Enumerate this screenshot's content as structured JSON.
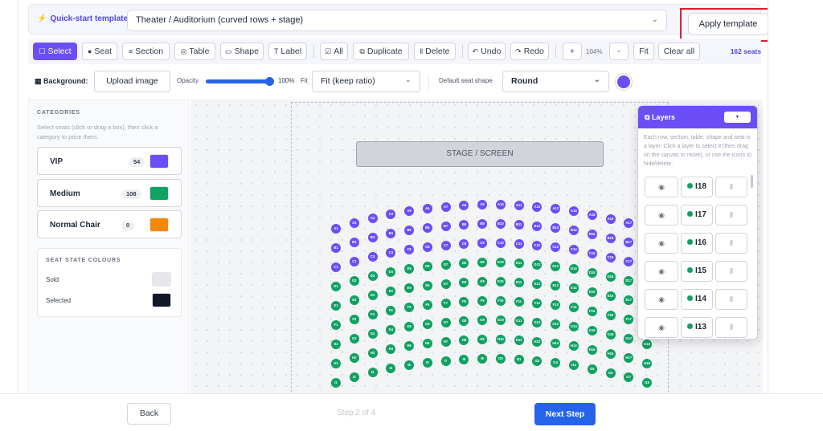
{
  "quickstart": {
    "label": "Quick-start template:",
    "selected": "Theater / Auditorium (curved rows + stage)",
    "apply_label": "Apply template"
  },
  "toolbar": {
    "buttons": [
      {
        "label": "Select",
        "icon": "☐"
      },
      {
        "label": "Seat",
        "icon": "●"
      },
      {
        "label": "Section",
        "icon": "≡"
      },
      {
        "label": "Table",
        "icon": "◎"
      },
      {
        "label": "Shape",
        "icon": "▭"
      },
      {
        "label": "Label",
        "icon": "T"
      },
      {
        "label": "All",
        "icon": "☑"
      },
      {
        "label": "Duplicate",
        "icon": "⧉"
      },
      {
        "label": "Delete",
        "icon": "‖"
      },
      {
        "label": "Undo",
        "icon": "↶"
      },
      {
        "label": "Redo",
        "icon": "↷"
      }
    ],
    "zoom_in": "+",
    "zoom_level": "104%",
    "zoom_out": "-",
    "fit": "Fit",
    "clear": "Clear all",
    "seat_count": "162 seats"
  },
  "background": {
    "label": "Background:",
    "upload": "Upload image",
    "opacity_label": "Opacity",
    "opacity_value": "100%",
    "opacity": 1.0,
    "fit_label": "Fit",
    "fit_value": "Fit (keep ratio)",
    "shape_label": "Default seat shape",
    "shape_value": "Round",
    "seat_color": "#6b4ef5"
  },
  "sidebar": {
    "categories_title": "CATEGORIES",
    "help": "Select seats (click or drag a box), then click a category to price them.",
    "categories": [
      {
        "name": "VIP",
        "count": "54",
        "color": "#6b4ef5"
      },
      {
        "name": "Medium",
        "count": "108",
        "color": "#10a163"
      },
      {
        "name": "Normal Chair",
        "count": "0",
        "color": "#f4880b"
      }
    ],
    "state_title": "SEAT STATE COLOURS",
    "states": [
      {
        "name": "Sold",
        "color": "#e5e7eb"
      },
      {
        "name": "Selected",
        "color": "#111827"
      }
    ]
  },
  "canvas": {
    "stage_label": "STAGE / SCREEN",
    "rows": [
      "A",
      "B",
      "C",
      "D",
      "E",
      "F",
      "G",
      "H",
      "I"
    ],
    "row_colors": {
      "A": "#6b4ef5",
      "B": "#6b4ef5",
      "C": "#6b4ef5",
      "D": "#10a163",
      "E": "#10a163",
      "F": "#10a163",
      "G": "#10a163",
      "H": "#10a163",
      "I": "#10a163"
    },
    "seats_per_row": 18
  },
  "layers": {
    "title": "Layers",
    "toggle": "▾",
    "help": "Each row, section, table, shape and seat is a layer. Click a layer to select it (then drag on the canvas to move), or use the icons to hide/delete.",
    "items": [
      {
        "name": "I18"
      },
      {
        "name": "I17"
      },
      {
        "name": "I16"
      },
      {
        "name": "I15"
      },
      {
        "name": "I14"
      },
      {
        "name": "I13"
      }
    ]
  },
  "footer": {
    "back": "Back",
    "step": "Step 2 of 4",
    "next": "Next Step"
  }
}
